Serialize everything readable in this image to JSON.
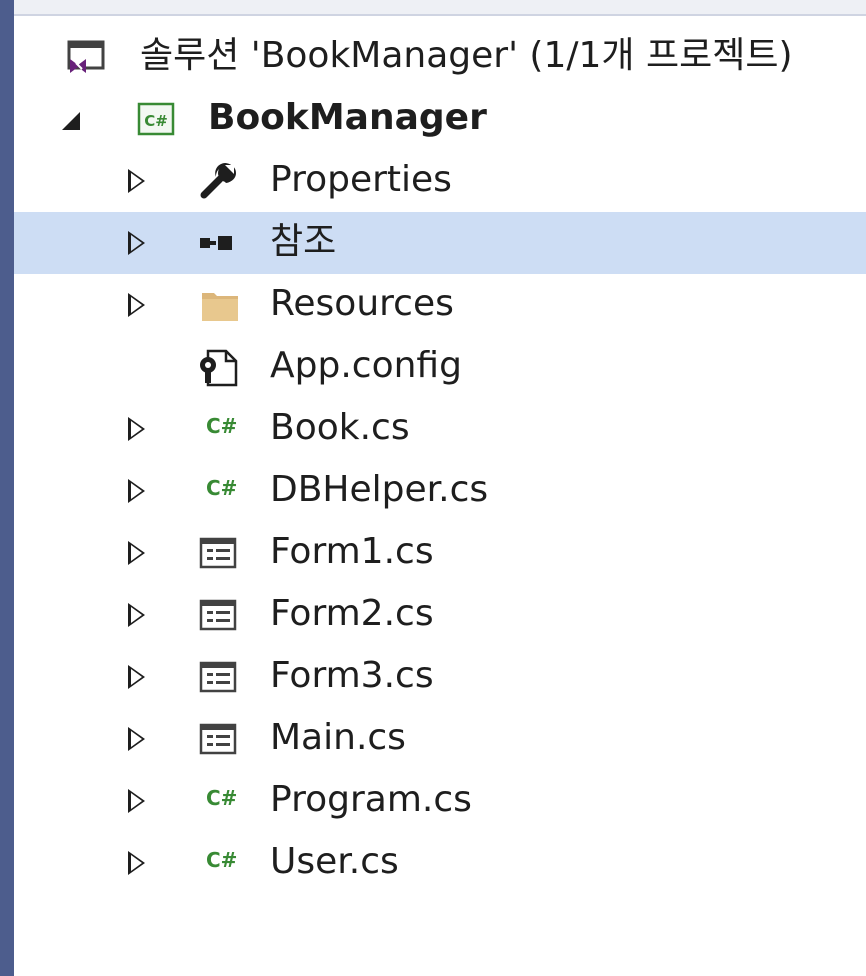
{
  "solution_explorer": {
    "solution_label": "솔루션 'BookManager' (1/1개 프로젝트)",
    "project": {
      "name": "BookManager",
      "icon": "csharp-project-icon"
    },
    "items": [
      {
        "label": "Properties",
        "icon": "wrench-icon",
        "expandable": true
      },
      {
        "label": "참조",
        "icon": "references-icon",
        "expandable": true,
        "selected": true
      },
      {
        "label": "Resources",
        "icon": "folder-icon",
        "expandable": true
      },
      {
        "label": "App.config",
        "icon": "config-file-icon",
        "expandable": false
      },
      {
        "label": "Book.cs",
        "icon": "csharp-file-icon",
        "expandable": true
      },
      {
        "label": "DBHelper.cs",
        "icon": "csharp-file-icon",
        "expandable": true
      },
      {
        "label": "Form1.cs",
        "icon": "form-icon",
        "expandable": true
      },
      {
        "label": "Form2.cs",
        "icon": "form-icon",
        "expandable": true
      },
      {
        "label": "Form3.cs",
        "icon": "form-icon",
        "expandable": true
      },
      {
        "label": "Main.cs",
        "icon": "form-icon",
        "expandable": true
      },
      {
        "label": "Program.cs",
        "icon": "csharp-file-icon",
        "expandable": true
      },
      {
        "label": "User.cs",
        "icon": "csharp-file-icon",
        "expandable": true
      }
    ],
    "csharp_glyph": "C#",
    "colors": {
      "selection": "#cdddf4",
      "csharp_green": "#388a34",
      "folder": "#dcb67a",
      "vs_purple": "#68217a"
    }
  }
}
